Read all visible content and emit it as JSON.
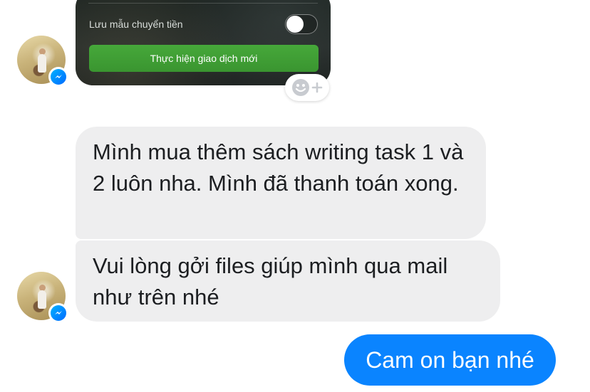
{
  "card": {
    "save_template_label": "Lưu mẫu chuyển tiền",
    "save_template_toggle_on": false,
    "new_transaction_label": "Thực hiện giao dịch mới"
  },
  "reaction": {
    "icon": "smiley-plus-icon"
  },
  "messages": [
    {
      "sender": "other",
      "text": "Mình mua thêm sách writing task 1 và 2 luôn nha. Mình đã thanh toán xong."
    },
    {
      "sender": "other",
      "text": "Vui lòng gởi files giúp mình qua mail như trên nhé"
    },
    {
      "sender": "me",
      "text": "Cam on bạn nhé"
    }
  ],
  "colors": {
    "incoming_bubble": "#eeeeef",
    "outgoing_bubble": "#0a84ff",
    "messenger_badge": "#006aff",
    "primary_green": "#3a9530"
  }
}
